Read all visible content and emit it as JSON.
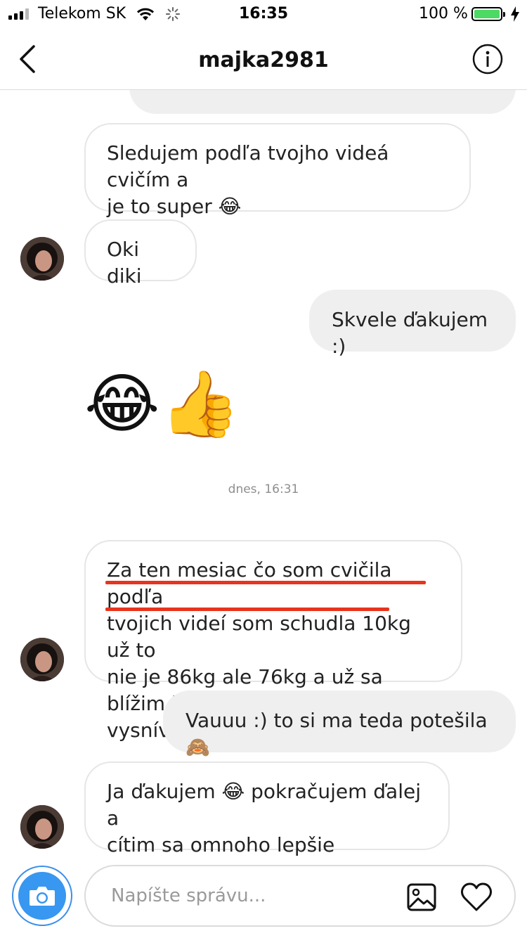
{
  "status_bar": {
    "carrier": "Telekom SK",
    "time": "16:35",
    "battery": "100 %"
  },
  "header": {
    "title": "majka2981"
  },
  "messages": [
    {
      "direction": "incoming",
      "text_lines": [
        "Sledujem podľa tvojho videá cvičím a",
        "je to super 😂"
      ]
    },
    {
      "direction": "incoming",
      "text_lines": [
        "Oki diki"
      ]
    },
    {
      "direction": "outgoing",
      "text_lines": [
        "Skvele ďakujem :)"
      ]
    },
    {
      "direction": "outgoing",
      "emoji": "😂👍"
    },
    {
      "direction": "incoming",
      "text_lines": [
        "Za ten mesiac čo som cvičila podľa",
        "tvojich videí som schudla 10kg už to",
        "nie je 86kg ale 76kg a už sa blížim k",
        "vysnívanému číslu 56kg 😂😂😂"
      ]
    },
    {
      "direction": "outgoing",
      "text_lines": [
        "Vauuu :) to si ma teda potešila 🙈"
      ]
    },
    {
      "direction": "incoming",
      "text_lines": [
        "Ja ďakujem 😂 pokračujem ďalej a",
        "cítim sa omnoho lepšie"
      ]
    }
  ],
  "timestamp": "dnes, 16:31",
  "composer": {
    "placeholder": "Napíšte správu..."
  },
  "colors": {
    "accent": "#3897f0",
    "underline": "#e8341c",
    "battery": "#4cd964",
    "outgoing_bubble": "#efefef"
  },
  "icons": [
    "signal-icon",
    "wifi-icon",
    "activity-spinner-icon",
    "battery-icon",
    "charging-bolt-icon",
    "back-chevron-icon",
    "info-icon",
    "camera-icon",
    "gallery-icon",
    "heart-icon"
  ]
}
